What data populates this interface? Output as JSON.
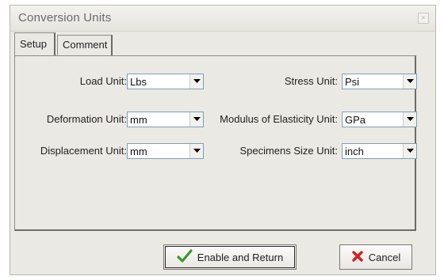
{
  "window": {
    "title": "Conversion Units",
    "close_label": "×"
  },
  "tabs": [
    {
      "label": "Setup",
      "active": true
    },
    {
      "label": "Comment",
      "active": false
    }
  ],
  "fields": {
    "load_unit": {
      "label": "Load Unit:",
      "value": "Lbs"
    },
    "deformation_unit": {
      "label": "Deformation Unit:",
      "value": "mm"
    },
    "displacement_unit": {
      "label": "Displacement Unit:",
      "value": "mm"
    },
    "stress_unit": {
      "label": "Stress Unit:",
      "value": "Psi"
    },
    "modulus_unit": {
      "label": "Modulus of Elasticity Unit:",
      "value": "GPa"
    },
    "specimen_size_unit": {
      "label": "Specimens Size Unit:",
      "value": "inch"
    }
  },
  "buttons": {
    "enable_return": {
      "label": "Enable and Return",
      "icon": "checkmark-icon",
      "color": "#3a9a2a"
    },
    "cancel": {
      "label": "Cancel",
      "icon": "x-icon",
      "color": "#d11f1f"
    }
  }
}
